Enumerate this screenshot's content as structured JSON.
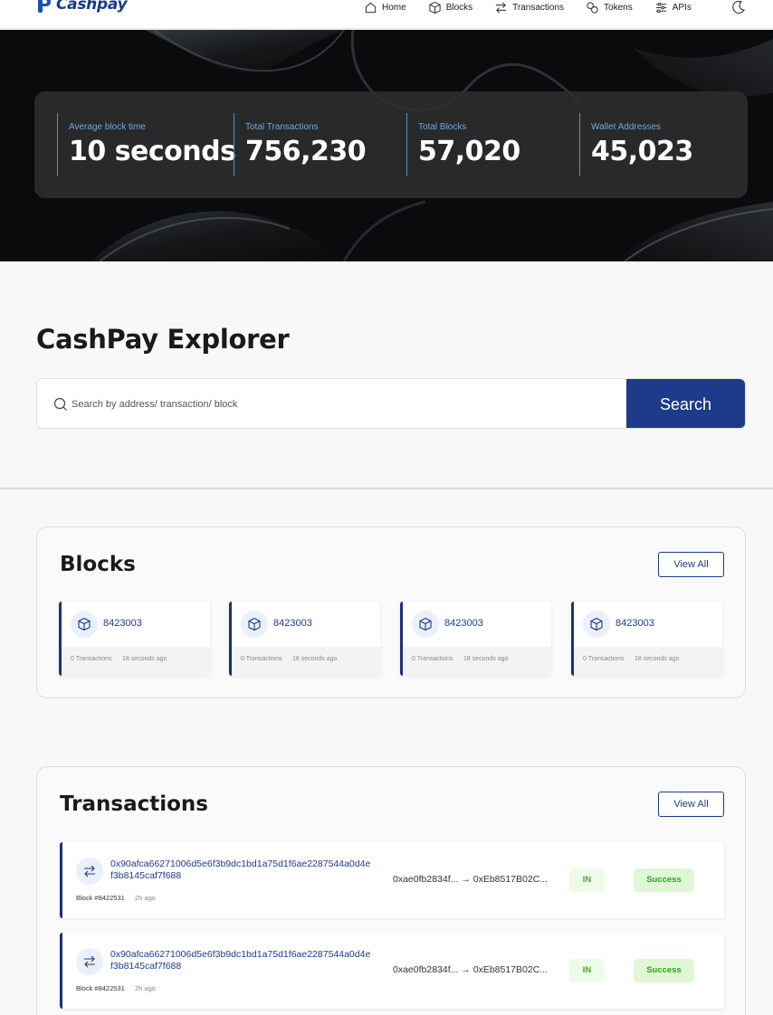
{
  "brand": {
    "name": "Cashpay",
    "color": "#1a3a8c"
  },
  "nav": {
    "items": [
      {
        "label": "Home",
        "icon": "home-icon"
      },
      {
        "label": "Blocks",
        "icon": "cube-icon"
      },
      {
        "label": "Transactions",
        "icon": "swap-icon"
      },
      {
        "label": "Tokens",
        "icon": "tokens-icon"
      },
      {
        "label": "APIs",
        "icon": "api-icon"
      }
    ],
    "theme_icon": "moon-icon"
  },
  "stats": [
    {
      "label": "Average block time",
      "value": "10 seconds"
    },
    {
      "label": "Total Transactions",
      "value": "756,230"
    },
    {
      "label": "Total Blocks",
      "value": "57,020"
    },
    {
      "label": "Wallet Addresses",
      "value": "45,023"
    }
  ],
  "explorer": {
    "title": "CashPay Explorer",
    "search_placeholder": "Search by address/ transaction/ block",
    "search_button": "Search"
  },
  "blocks": {
    "title": "Blocks",
    "view_all": "View All",
    "items": [
      {
        "number": "8423003",
        "transactions": "0 Transactions",
        "age": "18 seconds ago"
      },
      {
        "number": "8423003",
        "transactions": "0 Transactions",
        "age": "18 seconds ago"
      },
      {
        "number": "8423003",
        "transactions": "0 Transactions",
        "age": "18 seconds ago"
      },
      {
        "number": "8423003",
        "transactions": "0 Transactions",
        "age": "18 seconds ago"
      }
    ]
  },
  "transactions": {
    "title": "Transactions",
    "view_all": "View All",
    "items": [
      {
        "hash": "0x90afca66271006d5e6f3b9dc1bd1a75d1f6ae2287544a0d4ef3b8145caf7f688",
        "block": "Block #8422531",
        "age": "2h ago",
        "route": "0xae0fb2834f... → 0xEb8517B02C...",
        "direction": "IN",
        "status": "Success"
      },
      {
        "hash": "0x90afca66271006d5e6f3b9dc1bd1a75d1f6ae2287544a0d4ef3b8145caf7f688",
        "block": "Block #8422531",
        "age": "2h ago",
        "route": "0xae0fb2834f... → 0xEb8517B02C...",
        "direction": "IN",
        "status": "Success"
      }
    ]
  },
  "colors": {
    "accent": "#1e3a8a",
    "stat_label": "#6ea8e6",
    "success": "#2fa11f"
  }
}
